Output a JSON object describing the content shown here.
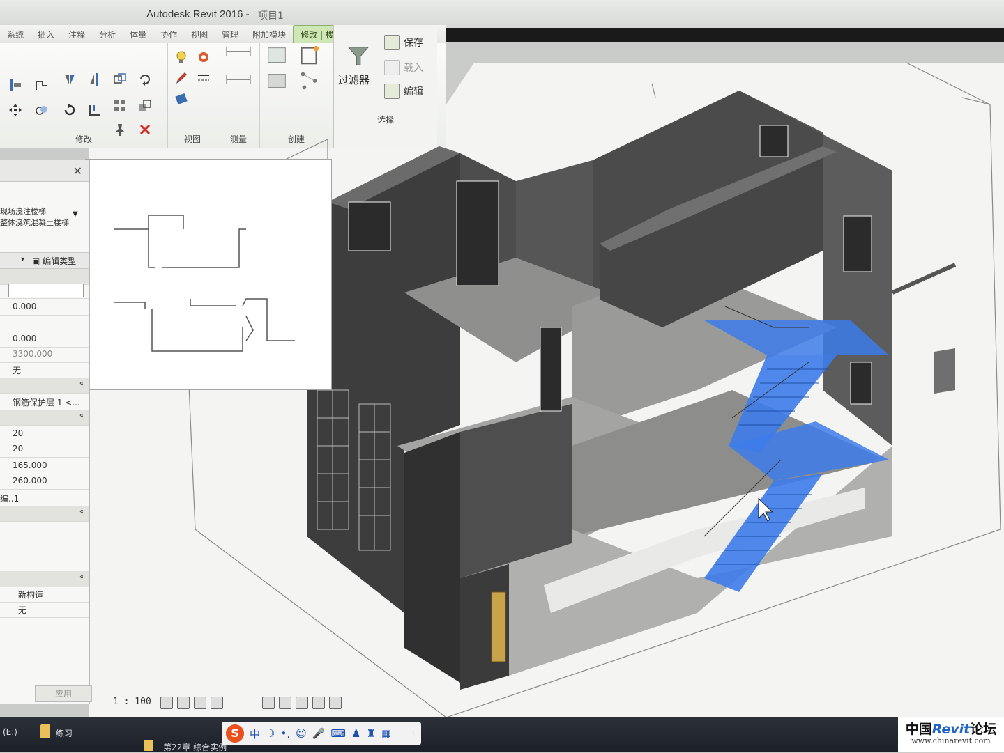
{
  "app": {
    "title": "Autodesk Revit 2016 -",
    "title_suffix": "项目1"
  },
  "ribbon": {
    "tabs": [
      "系统",
      "插入",
      "注释",
      "分析",
      "体量",
      "协作",
      "视图",
      "管理",
      "附加模块",
      "修改 | 楼梯"
    ],
    "active_tab": "修改 | 楼梯",
    "groups": {
      "modify": "修改",
      "view": "视图",
      "measure": "测量",
      "create": "创建",
      "select": "选择"
    },
    "filter_label": "过滤器",
    "save_label": "保存",
    "load_label": "载入",
    "edit_label": "编辑"
  },
  "properties": {
    "type_line1": "现场浇注楼梯",
    "type_line2": "整体浇筑混凝土楼梯",
    "edit_type": "编辑类型",
    "rows": [
      {
        "value": ""
      },
      {
        "value": "0.000"
      },
      {
        "value": ""
      },
      {
        "value": "0.000"
      },
      {
        "value": "3300.000"
      },
      {
        "value": "无"
      },
      {
        "value": ""
      },
      {
        "value": "钢筋保护层 1 <..."
      },
      {
        "value": ""
      },
      {
        "value": "20"
      },
      {
        "value": "20"
      },
      {
        "value": "165.000"
      },
      {
        "value": "260.000"
      },
      {
        "value": "编..1"
      }
    ],
    "phase_rows": [
      {
        "value": "新构造"
      },
      {
        "value": "无"
      }
    ],
    "apply": "应用"
  },
  "status": {
    "scale": "1 : 100"
  },
  "taskbar": {
    "drive": "(E:)",
    "folder": "练习",
    "doc": "第22章 综合实例",
    "ime_zh": "中"
  },
  "watermark": {
    "prefix": "中国",
    "brand": "Revit",
    "suffix": "论坛",
    "url": "www.chinarevit.com"
  },
  "colors": {
    "selection": "#3d7bea",
    "model_dark": "#4a4b4a",
    "ribbon_active": "#cfe6b7"
  }
}
